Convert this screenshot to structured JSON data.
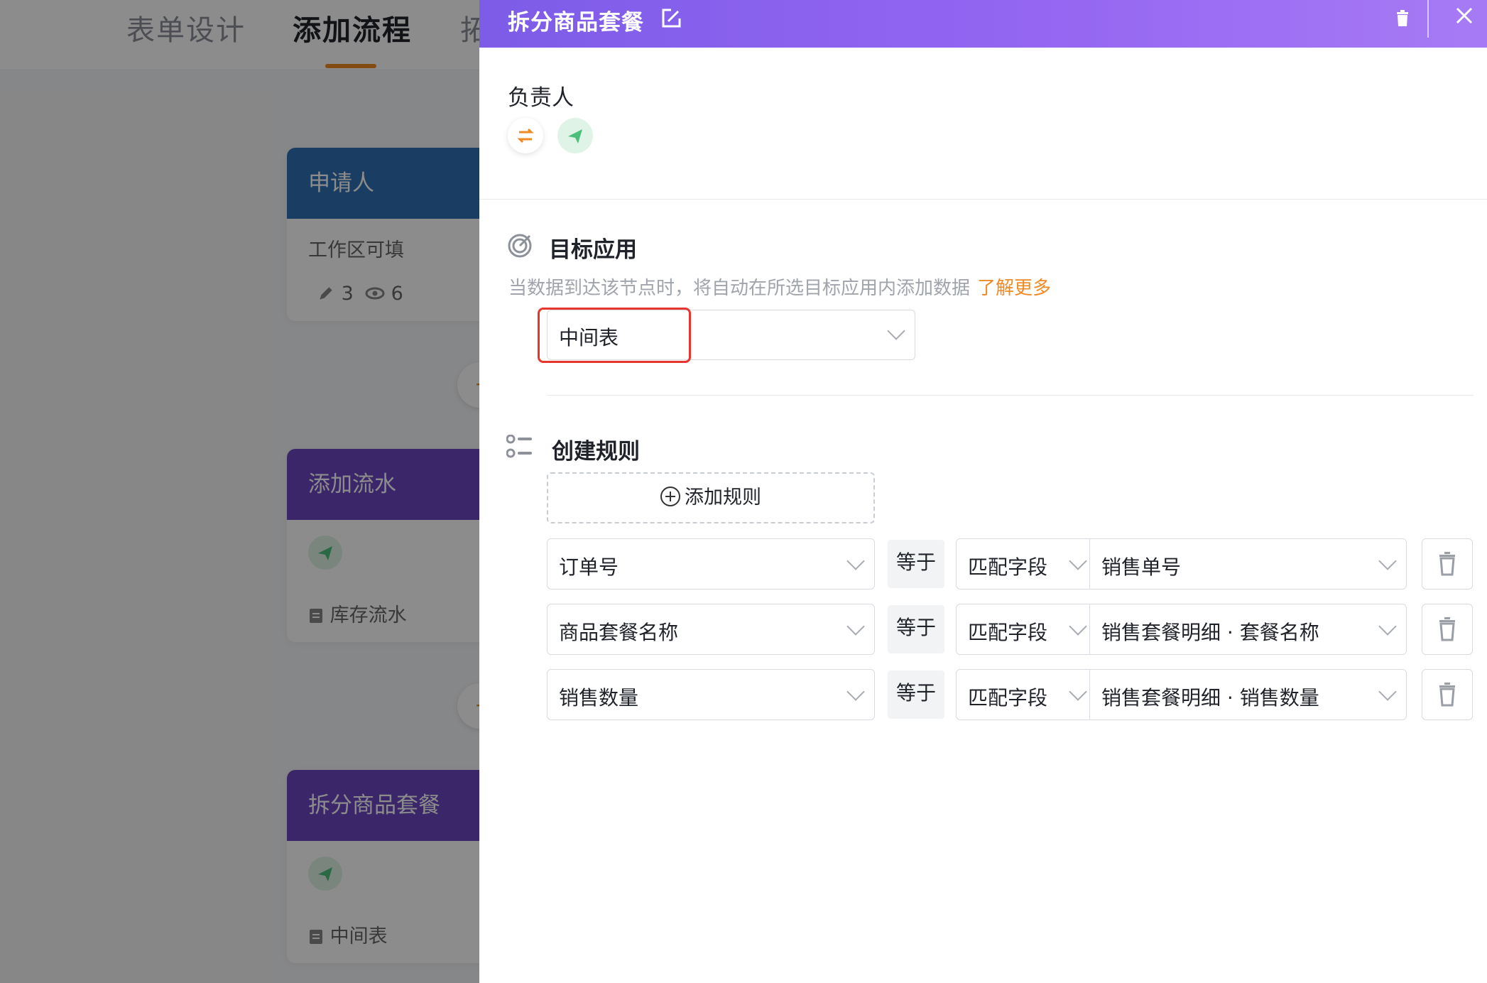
{
  "background": {
    "tabs": [
      {
        "label": "表单设计",
        "active": false
      },
      {
        "label": "添加流程",
        "active": true
      },
      {
        "label": "拓",
        "active": false
      }
    ],
    "nodes": [
      {
        "title": "申请人",
        "color": "#2f6fb4",
        "subtitle": "工作区可填",
        "edit_count": "3",
        "view_count": "6"
      },
      {
        "title": "添加流水",
        "color": "#6a45c0",
        "table": "库存流水"
      },
      {
        "title": "拆分商品套餐",
        "color": "#6a45c0",
        "table": "中间表"
      }
    ]
  },
  "panel": {
    "title": "拆分商品套餐",
    "owner_label": "负责人",
    "target": {
      "title": "目标应用",
      "description": "当数据到达该节点时，将自动在所选目标应用内添加数据",
      "learn_more": "了解更多",
      "selected": "中间表"
    },
    "rules": {
      "title": "创建规则",
      "add_label": "添加规则",
      "rows": [
        {
          "field": "订单号",
          "operator": "等于",
          "match_type": "匹配字段",
          "value": "销售单号"
        },
        {
          "field": "商品套餐名称",
          "operator": "等于",
          "match_type": "匹配字段",
          "value": "销售套餐明细 · 套餐名称"
        },
        {
          "field": "销售数量",
          "operator": "等于",
          "match_type": "匹配字段",
          "value": "销售套餐明细 · 销售数量"
        }
      ]
    }
  },
  "colors": {
    "accent_orange": "#f08a24",
    "header_purple": "#8a62ee",
    "highlight_red": "#e8352e",
    "send_green": "#4cc07a"
  }
}
